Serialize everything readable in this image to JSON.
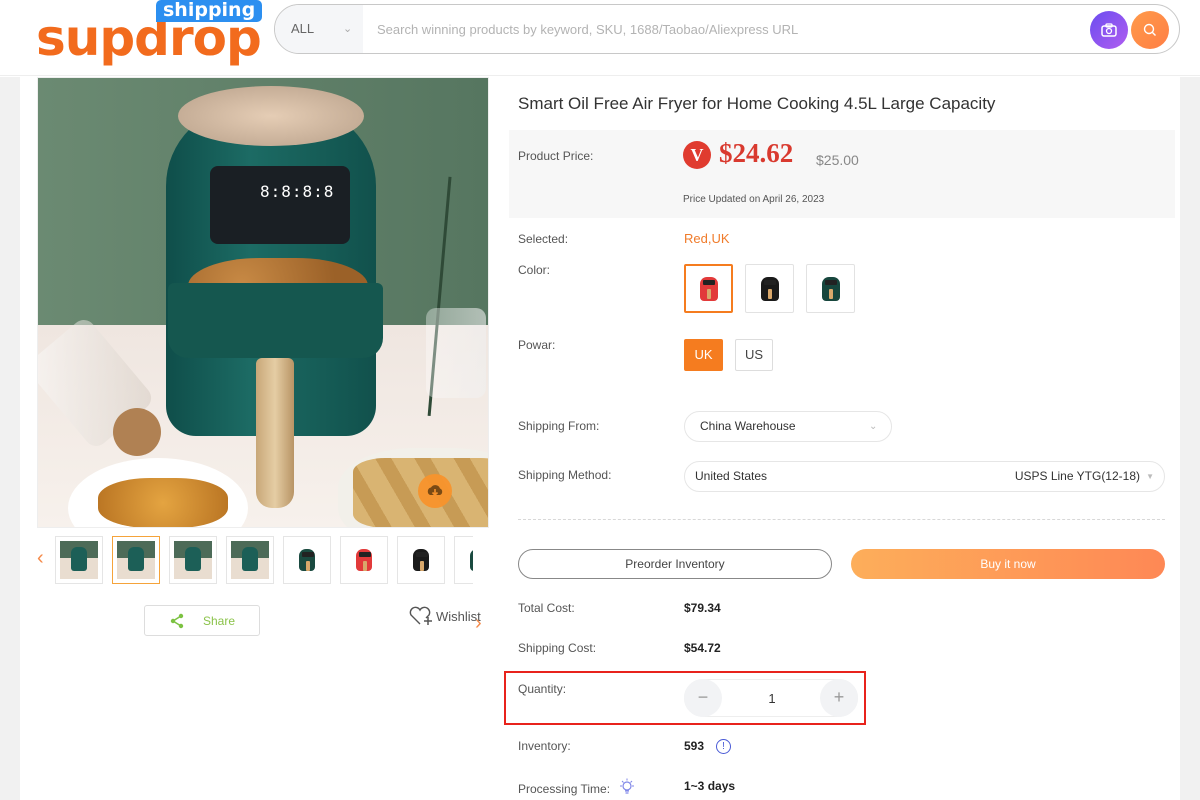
{
  "header": {
    "logo_text": "supdrop",
    "logo_badge": "shipping",
    "search": {
      "scope_value": "ALL",
      "placeholder": "Search winning products by keyword, SKU, 1688/Taobao/Aliexpress URL",
      "value": ""
    },
    "icons": {
      "camera": "camera-icon",
      "search": "search-icon"
    }
  },
  "gallery": {
    "main_image_alt": "Green air fryer with fried chicken",
    "main_display_digits": "8:8:8:8",
    "thumbnails": [
      {
        "label": "green fryer scene 1",
        "color": "#1c5f57",
        "active": false
      },
      {
        "label": "green fryer scene 2",
        "color": "#1c5f57",
        "active": true
      },
      {
        "label": "green fryer scene 3",
        "color": "#1c5f57",
        "active": false
      },
      {
        "label": "green fryer scene 4",
        "color": "#1c5f57",
        "active": false
      },
      {
        "label": "green fryer",
        "color": "#1a4a40",
        "active": false
      },
      {
        "label": "red fryer",
        "color": "#e23a3a",
        "active": false
      },
      {
        "label": "black fryer",
        "color": "#1a1a1a",
        "active": false
      },
      {
        "label": "green fryer 2",
        "color": "#1a4a40",
        "active": false
      }
    ],
    "share_label": "Share",
    "wishlist_label": "Wishlist"
  },
  "product": {
    "title": "Smart Oil Free Air Fryer for Home Cooking 4.5L Large Capacity",
    "price": {
      "label": "Product Price:",
      "badge": "V",
      "current": "$24.62",
      "original": "$25.00",
      "updated": "Price Updated on April 26, 2023"
    },
    "selected": {
      "label": "Selected:",
      "value": "Red,UK"
    },
    "color": {
      "label": "Color:",
      "options": [
        {
          "name": "Red",
          "swatch": "#e23a3a",
          "active": true
        },
        {
          "name": "Black",
          "swatch": "#1a1a1a",
          "active": false
        },
        {
          "name": "Green",
          "swatch": "#17463d",
          "active": false
        }
      ]
    },
    "power": {
      "label": "Powar:",
      "options": [
        {
          "name": "UK",
          "active": true
        },
        {
          "name": "US",
          "active": false
        }
      ]
    },
    "shipping_from": {
      "label": "Shipping From:",
      "value": "China Warehouse"
    },
    "shipping_method": {
      "label": "Shipping Method:",
      "country": "United States",
      "method": "USPS Line YTG(12-18)"
    },
    "actions": {
      "preorder": "Preorder Inventory",
      "buy": "Buy it now"
    },
    "total_cost": {
      "label": "Total Cost:",
      "value": "$79.34"
    },
    "shipping_cost": {
      "label": "Shipping Cost:",
      "value": "$54.72"
    },
    "quantity": {
      "label": "Quantity:",
      "value": "1",
      "minus": "−",
      "plus": "+"
    },
    "inventory": {
      "label": "Inventory:",
      "value": "593",
      "info": "!"
    },
    "processing_time": {
      "label": "Processing Time:",
      "value": "1~3 days"
    }
  },
  "colors": {
    "brand_orange": "#f26b1d",
    "brand_blue": "#2c8ff0",
    "price_red": "#d93a2f",
    "accent_orange": "#f57c1f",
    "highlight_red": "#e8231c"
  }
}
